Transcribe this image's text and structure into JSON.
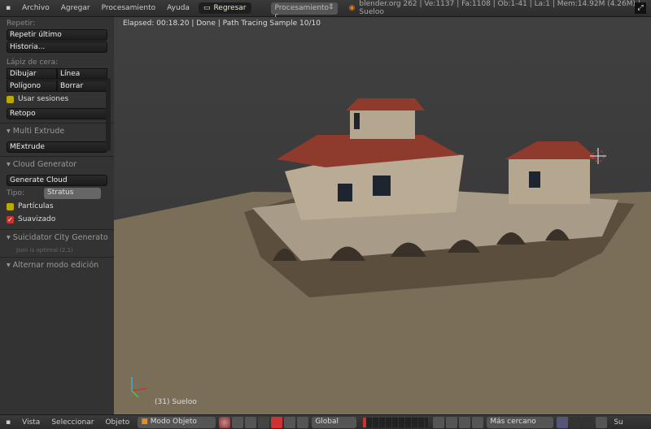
{
  "top": {
    "menus": [
      "Archivo",
      "Agregar",
      "Procesamiento",
      "Ayuda"
    ],
    "back_button": "Regresar",
    "scene_select": "Procesamiento c",
    "stats": "blender.org 262 | Ve:1137 | Fa:1108 | Ob:1-41 | La:1 | Mem:14.92M (4.26M) | Sueloo"
  },
  "left": {
    "repeat_label": "Repetir:",
    "repeat_last": "Repetir último",
    "history": "Historia...",
    "grease_label": "Lápiz de cera:",
    "draw": "Dibujar",
    "line": "Línea",
    "poly": "Polígono",
    "erase": "Borrar",
    "use_sessions": "Usar sesiones",
    "retopo": "Retopo",
    "multi_extrude": "Multi Extrude",
    "mextrude": "MExtrude",
    "cloud_gen": "Cloud Generator",
    "generate_cloud": "Generate Cloud",
    "type_label": "Tipo:",
    "type_value": "Stratus",
    "particles": "Partículas",
    "smooth": "Suavizado",
    "city_gen": "Suicidator City Generato",
    "city_note": "Json is optimal (2.1)",
    "toggle_edit": "Alternar modo edición"
  },
  "view": {
    "elapsed": "Elapsed: 00:18.20 | Done | Path Tracing Sample 10/10",
    "object": "(31) Sueloo"
  },
  "bottom": {
    "menus": [
      "Vista",
      "Seleccionar",
      "Objeto"
    ],
    "mode": "Modo Objeto",
    "orientation": "Global",
    "snap": "Más cercano",
    "extra": "Su"
  }
}
